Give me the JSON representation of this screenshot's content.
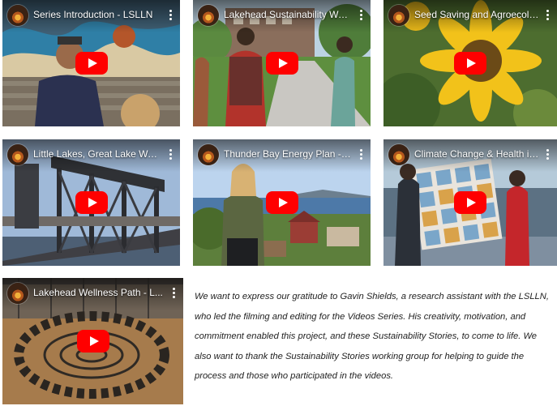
{
  "videos": [
    {
      "title": "Series Introduction - LSLLN"
    },
    {
      "title": "Lakehead Sustainability Wal..."
    },
    {
      "title": "Seed Saving and Agroecolo..."
    },
    {
      "title": "Little Lakes, Great Lake Wat..."
    },
    {
      "title": "Thunder Bay Energy Plan - L..."
    },
    {
      "title": "Climate Change & Health in ..."
    },
    {
      "title": "Lakehead Wellness Path - L..."
    }
  ],
  "caption": "We want to express our gratitude to Gavin Shields, a research assistant with the LSLLN, who led the filming and editing for the Videos Series. His creativity, motivation, and commitment enabled this project, and these Sustainability Stories, to come to life. We also want to thank the Sustainability Stories working group for helping to guide the process and those who participated in the videos.",
  "icons": {
    "play": "youtube-play-icon",
    "menu": "more-vert-icon",
    "avatar": "channel-avatar"
  },
  "colors": {
    "play_button": "#ff0000"
  }
}
